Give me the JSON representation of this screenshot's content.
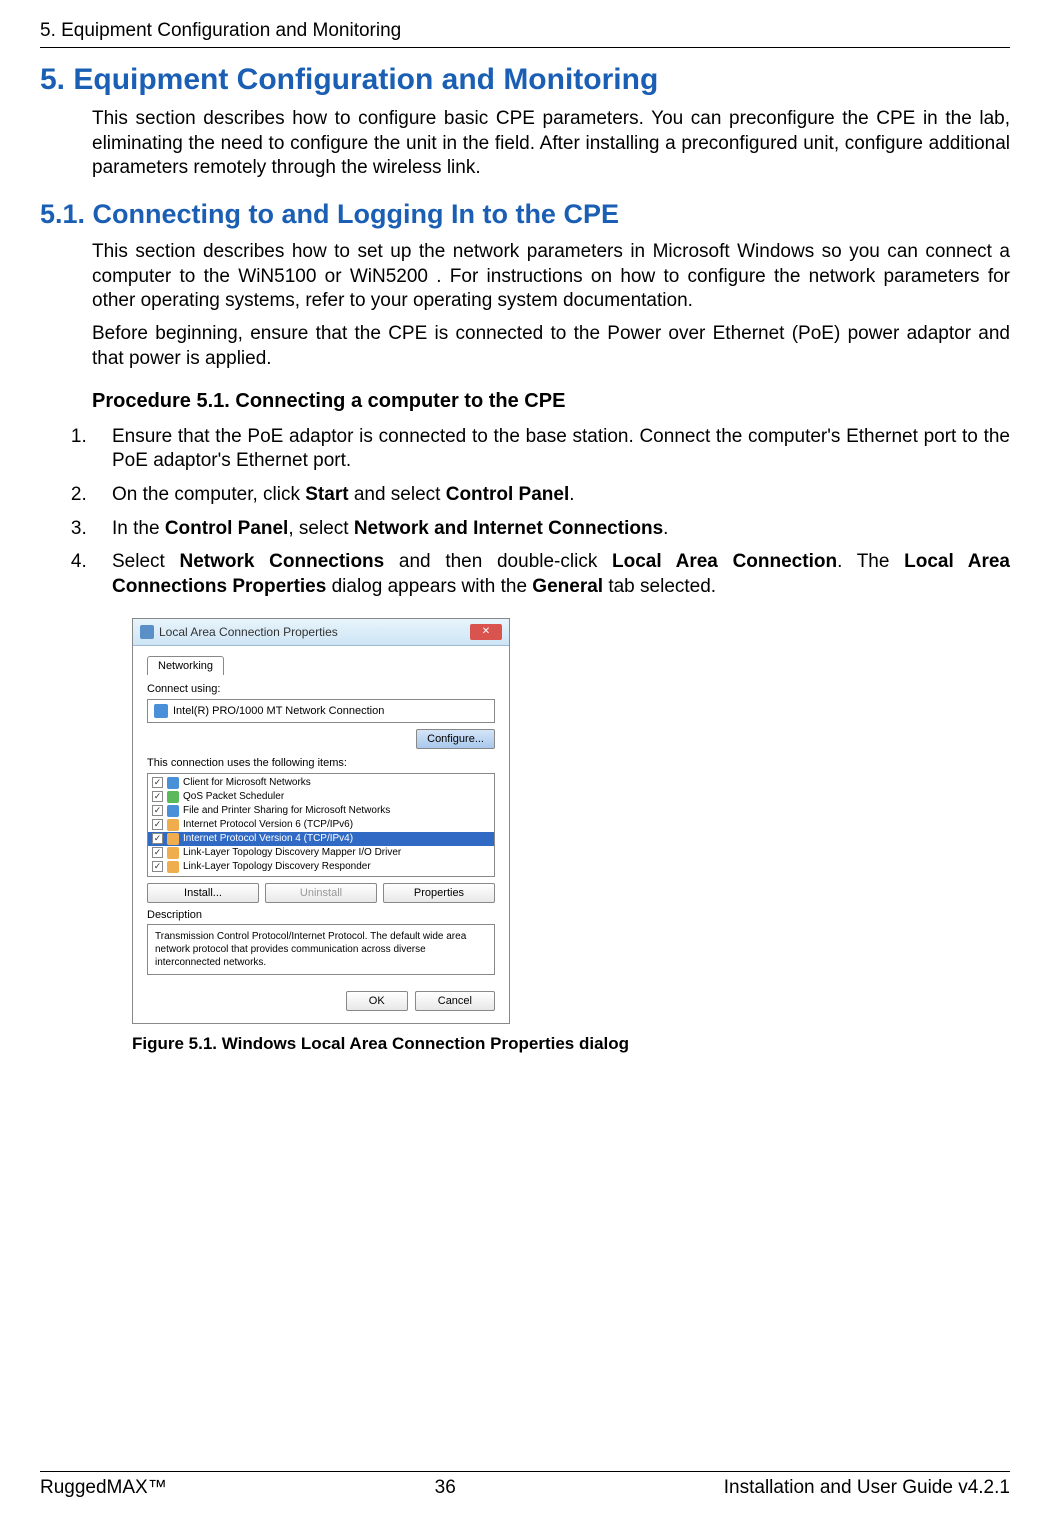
{
  "page_header": "5. Equipment Configuration and Monitoring",
  "h1": "5. Equipment Configuration and Monitoring",
  "intro_p": "This section describes how to configure basic CPE parameters. You can preconfigure the CPE in the lab, eliminating the need to configure the unit in the field. After installing a preconfigured unit, configure additional parameters remotely through the wireless link.",
  "h2": "5.1. Connecting to and Logging In to the CPE",
  "p2": "This section describes how to set up the network parameters in Microsoft Windows so you can connect a computer to the WiN5100 or WiN5200 . For instructions on how to configure the network parameters for other operating systems, refer to your operating system documentation.",
  "p3": "Before beginning, ensure that the CPE is connected to the Power over Ethernet (PoE) power adaptor and that power is applied.",
  "h3": "Procedure 5.1. Connecting a computer to the CPE",
  "steps": {
    "s1": "Ensure that the PoE adaptor is connected to the base station. Connect the computer's Ethernet port to the PoE adaptor's Ethernet port.",
    "s2a": "On the computer, click ",
    "s2b": "Start",
    "s2c": " and select ",
    "s2d": "Control Panel",
    "s2e": ".",
    "s3a": "In the ",
    "s3b": "Control Panel",
    "s3c": ", select ",
    "s3d": "Network and Internet Connections",
    "s3e": ".",
    "s4a": "Select ",
    "s4b": "Network Connections",
    "s4c": " and then double-click ",
    "s4d": "Local Area Connection",
    "s4e": ". The ",
    "s4f": "Local Area Connections Properties",
    "s4g": " dialog appears with the ",
    "s4h": "General",
    "s4i": " tab selected."
  },
  "dialog": {
    "title": "Local Area Connection Properties",
    "tab": "Networking",
    "connect_label": "Connect using:",
    "nic": "Intel(R) PRO/1000 MT Network Connection",
    "config_btn": "Configure...",
    "items_label": "This connection uses the following items:",
    "items": {
      "i0": "Client for Microsoft Networks",
      "i1": "QoS Packet Scheduler",
      "i2": "File and Printer Sharing for Microsoft Networks",
      "i3": "Internet Protocol Version 6 (TCP/IPv6)",
      "i4": "Internet Protocol Version 4 (TCP/IPv4)",
      "i5": "Link-Layer Topology Discovery Mapper I/O Driver",
      "i6": "Link-Layer Topology Discovery Responder"
    },
    "install_btn": "Install...",
    "uninstall_btn": "Uninstall",
    "properties_btn": "Properties",
    "desc_label": "Description",
    "desc_text": "Transmission Control Protocol/Internet Protocol. The default wide area network protocol that provides communication across diverse interconnected networks.",
    "ok_btn": "OK",
    "cancel_btn": "Cancel"
  },
  "figure_caption": "Figure 5.1. Windows Local Area Connection Properties dialog",
  "footer": {
    "left": "RuggedMAX™",
    "center": "36",
    "right": "Installation and User Guide v4.2.1"
  }
}
